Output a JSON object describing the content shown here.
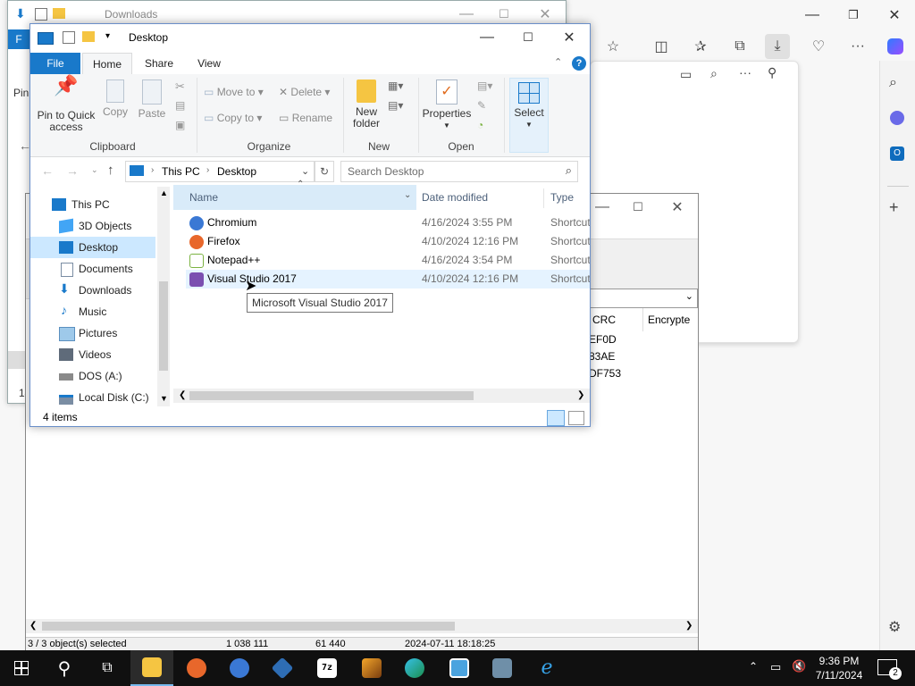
{
  "colors": {
    "accent": "#1979ca",
    "selection": "#cce8ff",
    "hover": "#e5f3ff",
    "taskbar": "#101010"
  },
  "back_window": {
    "title": "Downloads",
    "side_text_1": "Pin",
    "side_text_2": "F",
    "status_fragment": "14"
  },
  "seven_zip": {
    "columns": [
      "CRC",
      "Encrypte"
    ],
    "crc_values": [
      "EF0D",
      "83AE",
      "DF753"
    ],
    "status": {
      "selected": "3 / 3 object(s) selected",
      "size": "1 038 111",
      "packed": "61 440",
      "modified": "2024-07-11 18:18:25"
    }
  },
  "explorer": {
    "title": "Desktop",
    "tabs": {
      "file": "File",
      "home": "Home",
      "share": "Share",
      "view": "View"
    },
    "ribbon": {
      "pin": "Pin to Quick access",
      "copy": "Copy",
      "paste": "Paste",
      "move_to": "Move to",
      "copy_to": "Copy to",
      "delete": "Delete",
      "rename": "Rename",
      "new_folder": "New folder",
      "properties": "Properties",
      "select": "Select",
      "groups": {
        "clipboard": "Clipboard",
        "organize": "Organize",
        "new": "New",
        "open": "Open"
      }
    },
    "breadcrumb": {
      "this_pc": "This PC",
      "desktop": "Desktop"
    },
    "search_placeholder": "Search Desktop",
    "nav": [
      {
        "label": "This PC",
        "icon": "computer-icon"
      },
      {
        "label": "3D Objects",
        "icon": "cube-icon"
      },
      {
        "label": "Desktop",
        "icon": "desktop-icon"
      },
      {
        "label": "Documents",
        "icon": "document-icon"
      },
      {
        "label": "Downloads",
        "icon": "download-icon"
      },
      {
        "label": "Music",
        "icon": "music-icon"
      },
      {
        "label": "Pictures",
        "icon": "pictures-icon"
      },
      {
        "label": "Videos",
        "icon": "video-icon"
      },
      {
        "label": "DOS (A:)",
        "icon": "floppy-icon"
      },
      {
        "label": "Local Disk (C:)",
        "icon": "disk-icon"
      }
    ],
    "columns": {
      "name": "Name",
      "date": "Date modified",
      "type": "Type"
    },
    "files": [
      {
        "name": "Chromium",
        "date": "4/16/2024 3:55 PM",
        "type": "Shortcut",
        "color": "#3a78d4"
      },
      {
        "name": "Firefox",
        "date": "4/10/2024 12:16 PM",
        "type": "Shortcut",
        "color": "#e8672b"
      },
      {
        "name": "Notepad++",
        "date": "4/16/2024 3:54 PM",
        "type": "Shortcut",
        "color": "#7cb342"
      },
      {
        "name": "Visual Studio 2017",
        "date": "4/10/2024 12:16 PM",
        "type": "Shortcut",
        "color": "#7b4fb0"
      }
    ],
    "tooltip": "Microsoft Visual Studio 2017",
    "status": "4 items"
  },
  "tray": {
    "time": "9:36 PM",
    "date": "7/11/2024",
    "notifications": "2"
  }
}
